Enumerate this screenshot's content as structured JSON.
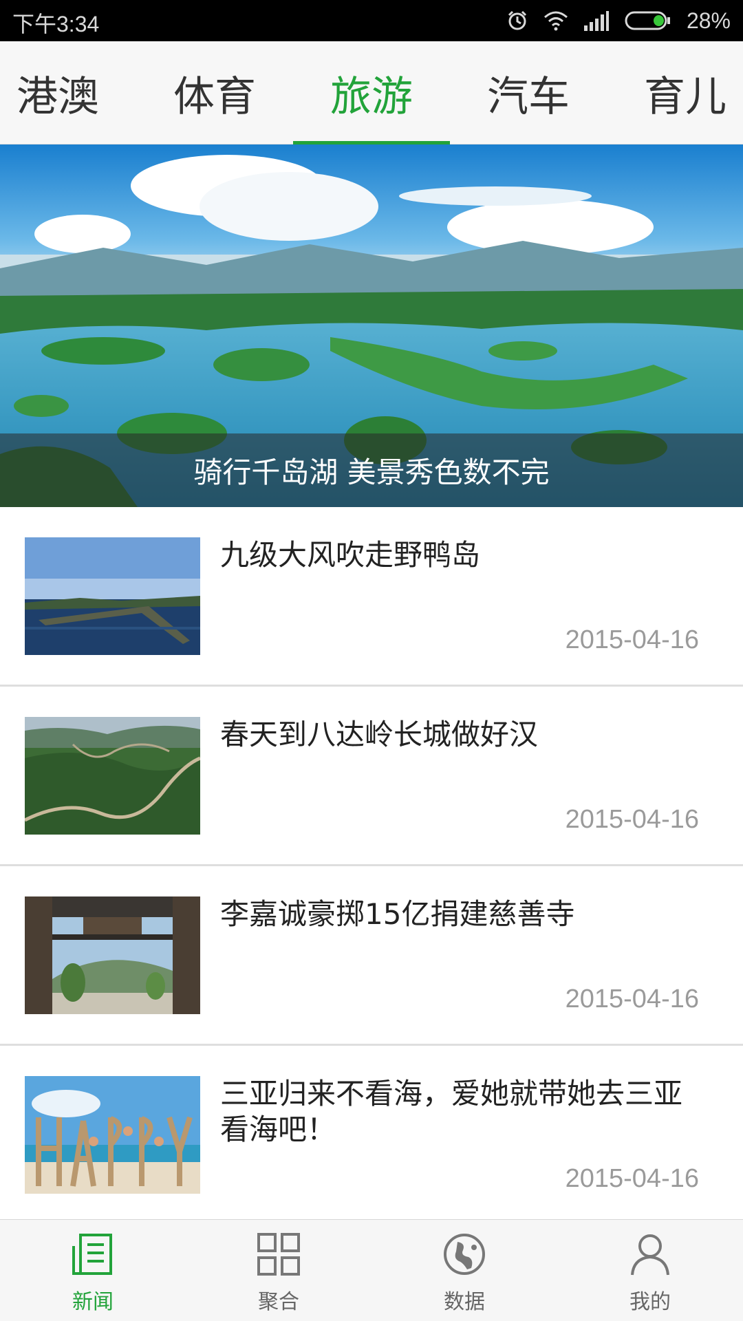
{
  "status_bar": {
    "time": "下午3:34",
    "battery": "28%",
    "icons": [
      "alarm-icon",
      "wifi-icon",
      "signal-icon",
      "battery-icon"
    ]
  },
  "tabs": [
    {
      "label": "港澳",
      "active": false
    },
    {
      "label": "体育",
      "active": false
    },
    {
      "label": "旅游",
      "active": true
    },
    {
      "label": "汽车",
      "active": false
    },
    {
      "label": "育儿",
      "active": false
    }
  ],
  "banner": {
    "caption": "骑行千岛湖 美景秀色数不完"
  },
  "news": [
    {
      "title": "九级大风吹走野鸭岛",
      "date": "2015-04-16"
    },
    {
      "title": "春天到八达岭长城做好汉",
      "date": "2015-04-16"
    },
    {
      "title": "李嘉诚豪掷15亿捐建慈善寺",
      "date": "2015-04-16"
    },
    {
      "title": "三亚归来不看海，爱她就带她去三亚看海吧！",
      "date": "2015-04-16"
    }
  ],
  "bottom_nav": [
    {
      "label": "新闻",
      "icon": "news-icon",
      "active": true
    },
    {
      "label": "聚合",
      "icon": "grid-icon",
      "active": false
    },
    {
      "label": "数据",
      "icon": "globe-icon",
      "active": false
    },
    {
      "label": "我的",
      "icon": "user-icon",
      "active": false
    }
  ],
  "colors": {
    "accent": "#22a33a",
    "status_bar": "#000000",
    "tab_bar": "#f7f7f7"
  }
}
